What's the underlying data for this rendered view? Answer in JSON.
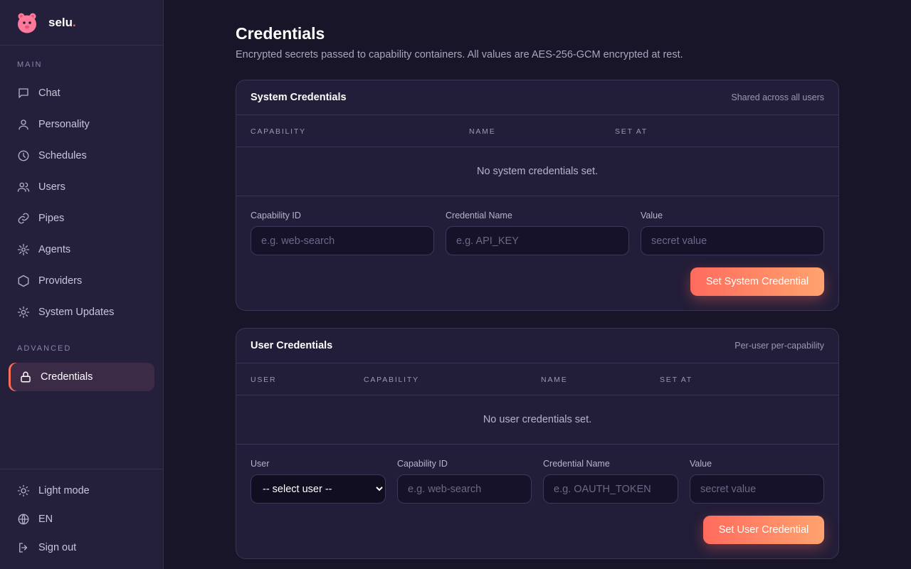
{
  "brand": {
    "name": "selu",
    "dot": "."
  },
  "sidebar": {
    "main_label": "MAIN",
    "advanced_label": "ADVANCED",
    "main_items": [
      {
        "label": "Chat",
        "icon": "chat-icon"
      },
      {
        "label": "Personality",
        "icon": "person-icon"
      },
      {
        "label": "Schedules",
        "icon": "clock-icon"
      },
      {
        "label": "Users",
        "icon": "users-icon"
      },
      {
        "label": "Pipes",
        "icon": "link-icon"
      },
      {
        "label": "Agents",
        "icon": "agents-icon"
      },
      {
        "label": "Providers",
        "icon": "hexagon-icon"
      },
      {
        "label": "System Updates",
        "icon": "gear-icon"
      }
    ],
    "advanced_items": [
      {
        "label": "Credentials",
        "icon": "lock-icon",
        "active": true
      }
    ],
    "footer": {
      "theme": "Light mode",
      "language": "EN",
      "signout": "Sign out"
    }
  },
  "page": {
    "title": "Credentials",
    "subtitle": "Encrypted secrets passed to capability containers. All values are AES-256-GCM encrypted at rest."
  },
  "system_card": {
    "title": "System Credentials",
    "note": "Shared across all users",
    "columns": [
      "CAPABILITY",
      "NAME",
      "SET AT"
    ],
    "empty": "No system credentials set.",
    "fields": {
      "capability_label": "Capability ID",
      "capability_placeholder": "e.g. web-search",
      "name_label": "Credential Name",
      "name_placeholder": "e.g. API_KEY",
      "value_label": "Value",
      "value_placeholder": "secret value"
    },
    "button": "Set System Credential"
  },
  "user_card": {
    "title": "User Credentials",
    "note": "Per-user per-capability",
    "columns": [
      "USER",
      "CAPABILITY",
      "NAME",
      "SET AT"
    ],
    "empty": "No user credentials set.",
    "fields": {
      "user_label": "User",
      "user_selected": "-- select user --",
      "capability_label": "Capability ID",
      "capability_placeholder": "e.g. web-search",
      "name_label": "Credential Name",
      "name_placeholder": "e.g. OAUTH_TOKEN",
      "value_label": "Value",
      "value_placeholder": "secret value"
    },
    "button": "Set User Credential"
  },
  "colors": {
    "accent_start": "#ff6b5d",
    "accent_end": "#ffa36e",
    "sidebar_bg": "#241f3b",
    "page_bg": "#191528"
  }
}
